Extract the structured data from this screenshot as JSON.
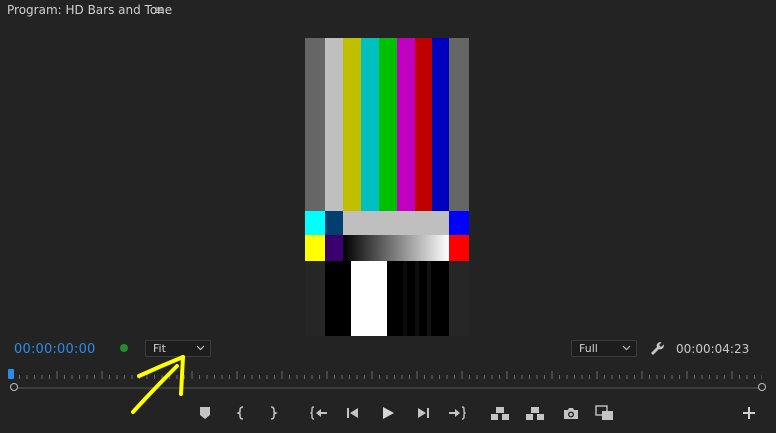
{
  "panel": {
    "title": "Program: HD Bars and Tone",
    "menu_glyph": "≡"
  },
  "timecode": {
    "current": "00:00:00:00",
    "duration": "00:00:04:23"
  },
  "zoom": {
    "selected": "Fit"
  },
  "quality": {
    "selected": "Full"
  },
  "colors": {
    "accent": "#2d8ceb",
    "status_dot": "#1f8f2a",
    "annotation": "#ffff00",
    "background": "#232323"
  },
  "icons": {
    "marker": "add-marker-icon",
    "mark_in": "mark-in-icon",
    "mark_out": "mark-out-icon",
    "go_to_in": "go-to-in-icon",
    "step_back": "step-back-icon",
    "play": "play-icon",
    "step_forward": "step-forward-icon",
    "go_to_out": "go-to-out-icon",
    "lift": "lift-icon",
    "extract": "extract-icon",
    "export_frame": "camera-icon",
    "comparison_view": "comparison-view-icon",
    "add_button": "plus-icon",
    "settings": "wrench-icon"
  }
}
